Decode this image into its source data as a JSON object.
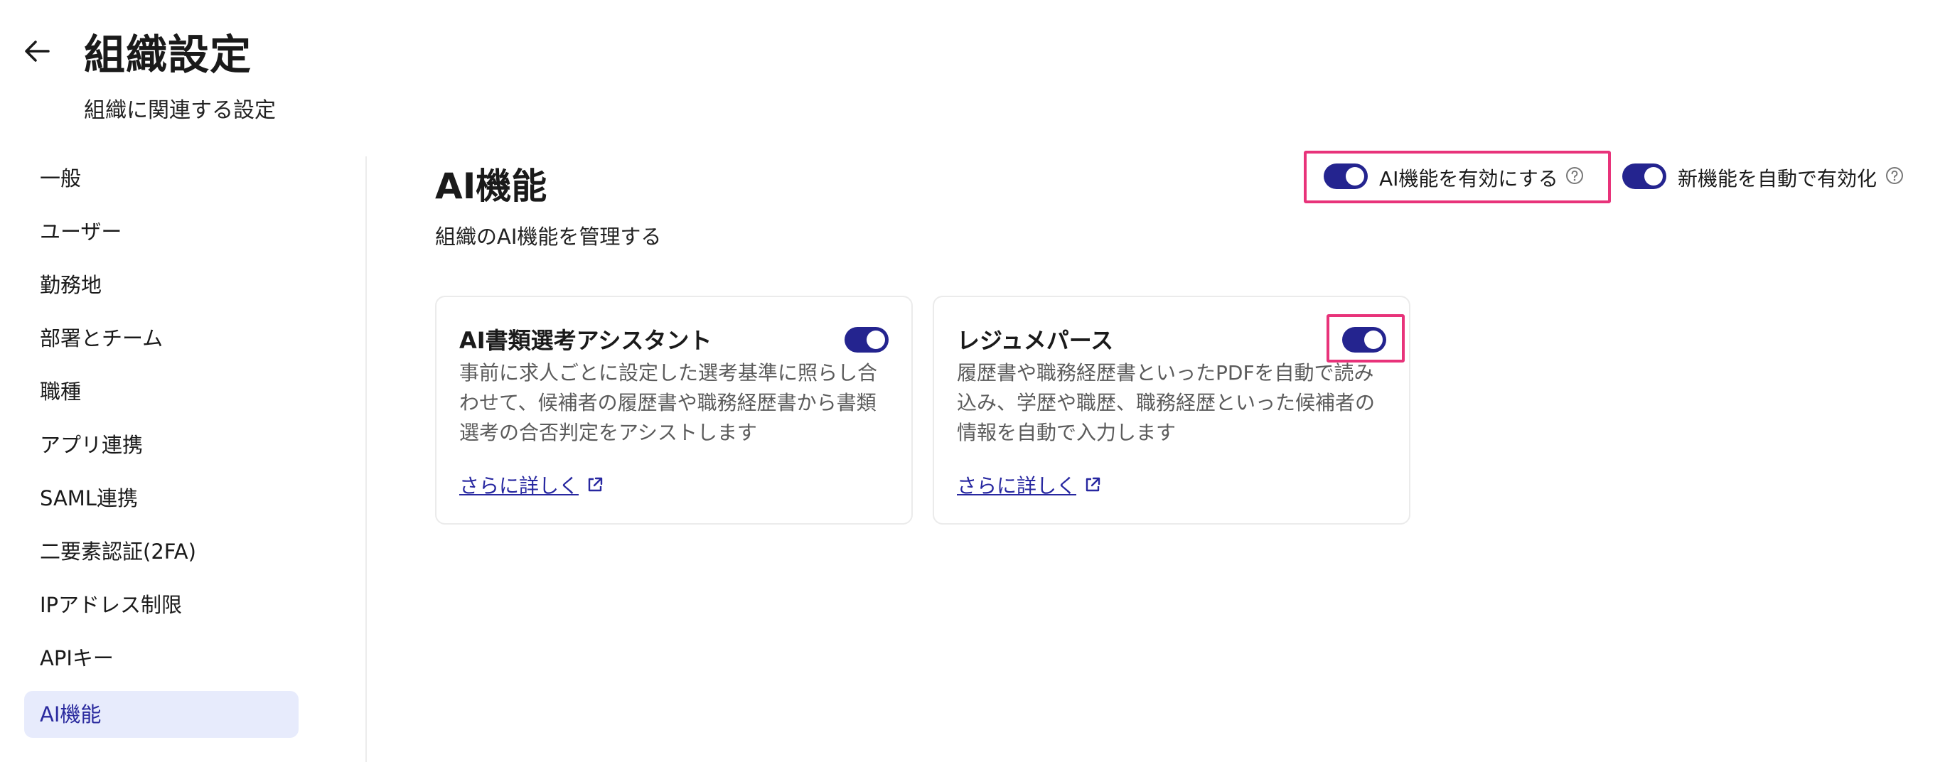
{
  "header": {
    "title": "組織設定",
    "subtitle": "組織に関連する設定"
  },
  "sidebar": {
    "items": [
      {
        "label": "一般",
        "active": false
      },
      {
        "label": "ユーザー",
        "active": false
      },
      {
        "label": "勤務地",
        "active": false
      },
      {
        "label": "部署とチーム",
        "active": false
      },
      {
        "label": "職種",
        "active": false
      },
      {
        "label": "アプリ連携",
        "active": false
      },
      {
        "label": "SAML連携",
        "active": false
      },
      {
        "label": "二要素認証(2FA)",
        "active": false
      },
      {
        "label": "IPアドレス制限",
        "active": false
      },
      {
        "label": "APIキー",
        "active": false
      },
      {
        "label": "AI機能",
        "active": true
      }
    ]
  },
  "main": {
    "title": "AI機能",
    "description": "組織のAI機能を管理する",
    "toggles": {
      "enable_ai": {
        "label": "AI機能を有効にする",
        "on": true
      },
      "auto_enable_new": {
        "label": "新機能を自動で有効化",
        "on": true
      }
    },
    "cards": [
      {
        "title": "AI書類選考アシスタント",
        "description": "事前に求人ごとに設定した選考基準に照らし合わせて、候補者の履歴書や職務経歴書から書類選考の合否判定をアシストします",
        "link": "さらに詳しく",
        "on": true
      },
      {
        "title": "レジュメパース",
        "description": "履歴書や職務経歴書といったPDFを自動で読み込み、学歴や職歴、職務経歴といった候補者の情報を自動で入力します",
        "link": "さらに詳しく",
        "on": true
      }
    ]
  },
  "colors": {
    "accent": "#24248f",
    "highlight": "#e8337a",
    "active_bg": "#e7ebfc"
  }
}
